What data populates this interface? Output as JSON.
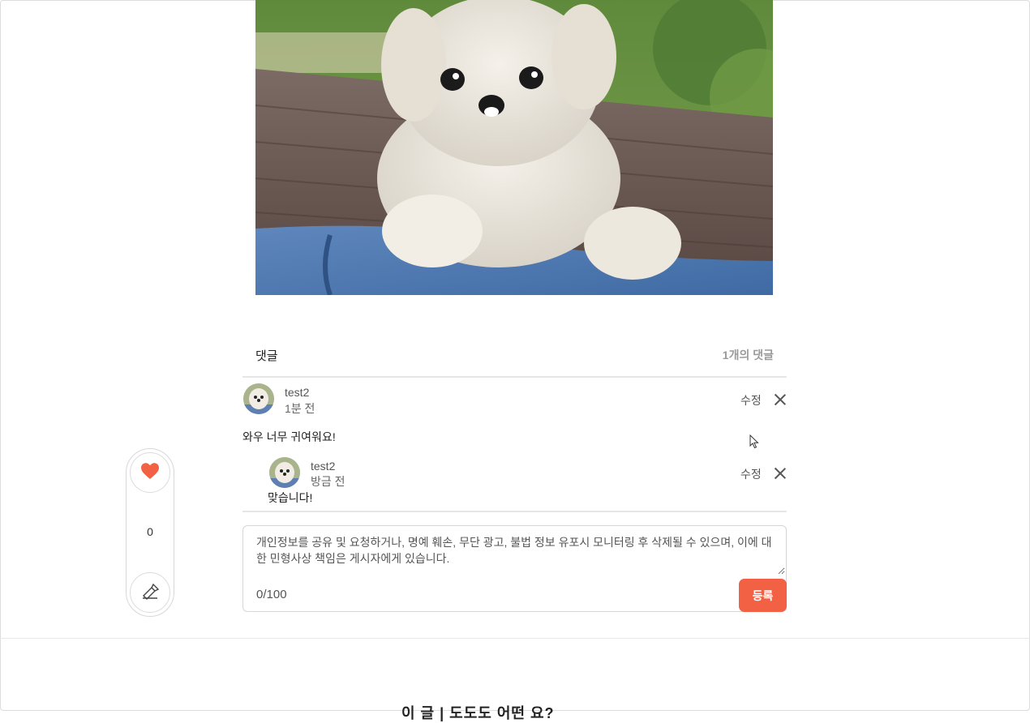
{
  "post": {
    "image_alt": "white puppy on jeans"
  },
  "comments_section": {
    "title": "댓글",
    "count_label": "1개의 댓글"
  },
  "comments": [
    {
      "username": "test2",
      "time": "1분 전",
      "edit_label": "수정",
      "text": "와우 너무 귀여워요!",
      "replies": [
        {
          "username": "test2",
          "time": "방금 전",
          "edit_label": "수정",
          "text": "맞습니다!"
        }
      ]
    }
  ],
  "comment_input": {
    "placeholder": "개인정보를 공유 및 요청하거나, 명예 훼손, 무단 광고, 불법 정보 유포시 모니터링 후 삭제될 수 있으며, 이에 대한 민형사상 책임은 게시자에게 있습니다.",
    "counter": "0/100",
    "submit_label": "등록"
  },
  "side_actions": {
    "like_count": "0",
    "icons": [
      "heart-icon",
      "share-icon"
    ]
  },
  "footer": {
    "teaser": "이 글 | 도도도 어떤 요?"
  },
  "colors": {
    "accent": "#f26144",
    "divider": "#e6e6e6",
    "muted": "#9a9a9a"
  }
}
